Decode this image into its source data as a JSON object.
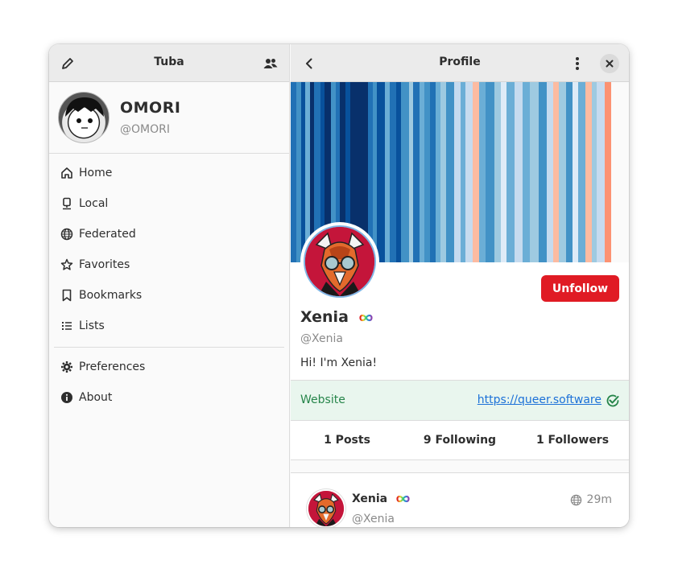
{
  "sidebar": {
    "title": "Tuba",
    "account": {
      "name": "OMORI",
      "handle": "@OMORI"
    },
    "items": [
      {
        "label": "Home",
        "icon": "home-icon"
      },
      {
        "label": "Local",
        "icon": "local-icon"
      },
      {
        "label": "Federated",
        "icon": "globe-icon"
      },
      {
        "label": "Favorites",
        "icon": "star-icon"
      },
      {
        "label": "Bookmarks",
        "icon": "bookmark-icon"
      },
      {
        "label": "Lists",
        "icon": "list-icon"
      }
    ],
    "footer_items": [
      {
        "label": "Preferences",
        "icon": "gear-icon"
      },
      {
        "label": "About",
        "icon": "info-icon"
      }
    ]
  },
  "main": {
    "title": "Profile",
    "profile": {
      "name": "Xenia",
      "handle": "@Xenia",
      "bio": "Hi! I'm Xenia!",
      "unfollow_label": "Unfollow",
      "field": {
        "label": "Website",
        "value": "https://queer.software"
      },
      "stats": {
        "posts": "1 Posts",
        "following": "9 Following",
        "followers": "1 Followers"
      }
    },
    "post": {
      "name": "Xenia",
      "handle": "@Xenia",
      "time": "29m"
    }
  },
  "colors": {
    "accent_destructive": "#e01b24",
    "verified_green": "#26854a",
    "link_blue": "#1c71d8",
    "banner_stripes": [
      "#08306b",
      "#08519c",
      "#2171b5",
      "#4292c6",
      "#6baed6",
      "#9ecae1",
      "#c6dbef",
      "#deebf7",
      "#fcbba1",
      "#fc9272"
    ]
  }
}
